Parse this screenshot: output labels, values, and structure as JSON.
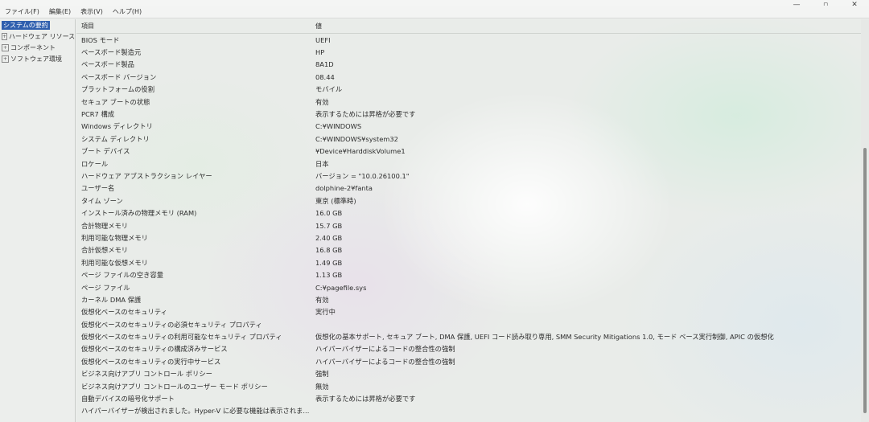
{
  "window": {
    "controls": [
      "—",
      "▫",
      "✕"
    ]
  },
  "menu": [
    "ファイル(F)",
    "編集(E)",
    "表示(V)",
    "ヘルプ(H)"
  ],
  "sidebar": {
    "items": [
      {
        "label": "システムの要約",
        "expander": ""
      },
      {
        "label": "ハードウェア リソース",
        "expander": "+"
      },
      {
        "label": "コンポーネント",
        "expander": "+"
      },
      {
        "label": "ソフトウェア環境",
        "expander": "+"
      }
    ]
  },
  "table": {
    "headers": {
      "item": "項目",
      "value": "値"
    },
    "rows": [
      {
        "item": "BIOS モード",
        "value": "UEFI"
      },
      {
        "item": "ベースボード製造元",
        "value": "HP"
      },
      {
        "item": "ベースボード製品",
        "value": "8A1D"
      },
      {
        "item": "ベースボード バージョン",
        "value": "08.44"
      },
      {
        "item": "プラットフォームの役割",
        "value": "モバイル"
      },
      {
        "item": "セキュア ブートの状態",
        "value": "有効"
      },
      {
        "item": "PCR7 構成",
        "value": "表示するためには昇格が必要です"
      },
      {
        "item": "Windows ディレクトリ",
        "value": "C:¥WINDOWS"
      },
      {
        "item": "システム ディレクトリ",
        "value": "C:¥WINDOWS¥system32"
      },
      {
        "item": "ブート デバイス",
        "value": "¥Device¥HarddiskVolume1"
      },
      {
        "item": "ロケール",
        "value": "日本"
      },
      {
        "item": "ハードウェア アブストラクション レイヤー",
        "value": "バージョン = \"10.0.26100.1\""
      },
      {
        "item": "ユーザー名",
        "value": "dolphine-2¥fanta"
      },
      {
        "item": "タイム ゾーン",
        "value": "東京 (標準時)"
      },
      {
        "item": "インストール済みの物理メモリ (RAM)",
        "value": "16.0 GB"
      },
      {
        "item": "合計物理メモリ",
        "value": "15.7 GB"
      },
      {
        "item": "利用可能な物理メモリ",
        "value": "2.40 GB"
      },
      {
        "item": "合計仮想メモリ",
        "value": "16.8 GB"
      },
      {
        "item": "利用可能な仮想メモリ",
        "value": "1.49 GB"
      },
      {
        "item": "ページ ファイルの空き容量",
        "value": "1.13 GB"
      },
      {
        "item": "ページ ファイル",
        "value": "C:¥pagefile.sys"
      },
      {
        "item": "カーネル DMA 保護",
        "value": "有効"
      },
      {
        "item": "仮想化ベースのセキュリティ",
        "value": "実行中"
      },
      {
        "item": "仮想化ベースのセキュリティの必須セキュリティ プロパティ",
        "value": ""
      },
      {
        "item": "仮想化ベースのセキュリティの利用可能なセキュリティ プロパティ",
        "value": "仮想化の基本サポート, セキュア ブート, DMA 保護, UEFI コード読み取り専用, SMM Security Mitigations 1.0, モード ベース実行制御, APIC の仮想化"
      },
      {
        "item": "仮想化ベースのセキュリティの構成済みサービス",
        "value": "ハイパーバイザーによるコードの整合性の強制"
      },
      {
        "item": "仮想化ベースのセキュリティの実行中サービス",
        "value": "ハイパーバイザーによるコードの整合性の強制"
      },
      {
        "item": "ビジネス向けアプリ コントロール ポリシー",
        "value": "強制"
      },
      {
        "item": "ビジネス向けアプリ コントロールのユーザー モード ポリシー",
        "value": "無効"
      },
      {
        "item": "自動デバイスの暗号化サポート",
        "value": "表示するためには昇格が必要です"
      },
      {
        "item": "ハイパーバイザーが検出されました。Hyper-V に必要な機能は表示されま...",
        "value": ""
      }
    ]
  }
}
